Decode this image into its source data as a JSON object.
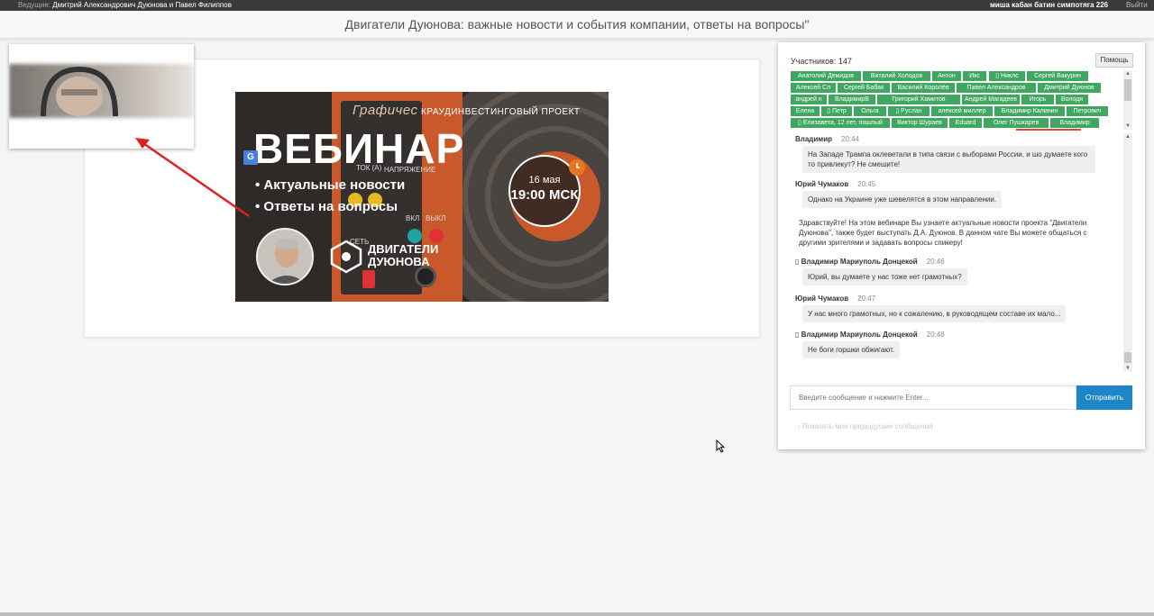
{
  "topbar": {
    "host_label": "Ведущие:",
    "host_names": "Дмитрий Александрович Дуюнова и Павел Филиппов",
    "user": "миша кабан батин симпотяга 226",
    "logout": "Выйти"
  },
  "title": "Двигатели Дуюнова: важные новости и события компании, ответы на вопросы\"",
  "banner": {
    "project": "КРАУДИНВЕСТИНГОВЫЙ ПРОЕКТ",
    "device_brand": "Графичес",
    "heading": "ВЕБИНАР",
    "bullets": [
      "• Актуальные новости",
      "• Ответы на вопросы"
    ],
    "device_labels": [
      "ТОК (А)",
      "НАПРЯЖЕНИЕ",
      "СЕТЬ",
      "ВКЛ",
      "ВЫКЛ"
    ],
    "date": "16 мая",
    "time": "19:00 МСК",
    "logo_line1": "ДВИГАТЕЛИ",
    "logo_line2": "ДУЮНОВА"
  },
  "chat": {
    "participants_label": "Участников: 147",
    "help": "Помощь",
    "participants": [
      "Анатолий Демидов",
      "Виталий Холодов",
      "Антон",
      "Икс",
      "▯ Никлс",
      "Сергей Вакурин",
      "Алексей Сл",
      "Сергей Бабак",
      "Василий Королёв",
      "Павел Александров",
      "Дмитрий Дуюнов",
      "андрей н",
      "ВладимирВ",
      "Григорий Хамитов",
      "Андрей Магадеев",
      "Игорь",
      "Володя",
      "Елена",
      "▯ Петр",
      "Ольга",
      "▯ Руслан",
      "алексей миллер",
      "Владимир Калинин",
      "Петрович",
      "▯ Елизавета, 12 лет, пошлый",
      "Виктор Шураев",
      "Eduard",
      "Олег Пушкарев",
      "Владимир"
    ],
    "messages": [
      {
        "author": "Владимир",
        "time": "20:44",
        "text": "На Западе Трампа оклеветали в типа связи с выборами России, и шо думаете кого то привлекут? Не смешите!"
      },
      {
        "author": "Юрий Чумаков",
        "time": "20:45",
        "text": "Однако на Украине уже шевелятся в этом направлении."
      },
      {
        "system": "Здравствуйте! На этом вебинаре Вы узнаете актуальные новости проекта \"Двигатели Дуюнова\", также будет выступать Д.А. Дуюнов. В данном чате Вы можете общаться с другими зрителями и задавать вопросы спикеру!"
      },
      {
        "author": "▯ Владимир Мариуполь Донцекой",
        "time": "20:46",
        "text": "Юрий, вы думаете у нас тоже нет грамотных?"
      },
      {
        "author": "Юрий Чумаков",
        "time": "20:47",
        "text": "У нас много грамотных, но к сожалению, в руководящем составе их мало..."
      },
      {
        "author": "▯ Владимир Мариуполь Донцекой",
        "time": "20:48",
        "text": "Не боги горшки обжигают."
      }
    ],
    "input_placeholder": "Введите сообщение и нажмите Enter...",
    "send": "Отправить",
    "prev_messages": "Показать мои предыдущие сообщения"
  },
  "colors": {
    "accent": "#1e85c7",
    "participant_tag": "#3fa75f",
    "banner_orange": "#c9582a"
  }
}
